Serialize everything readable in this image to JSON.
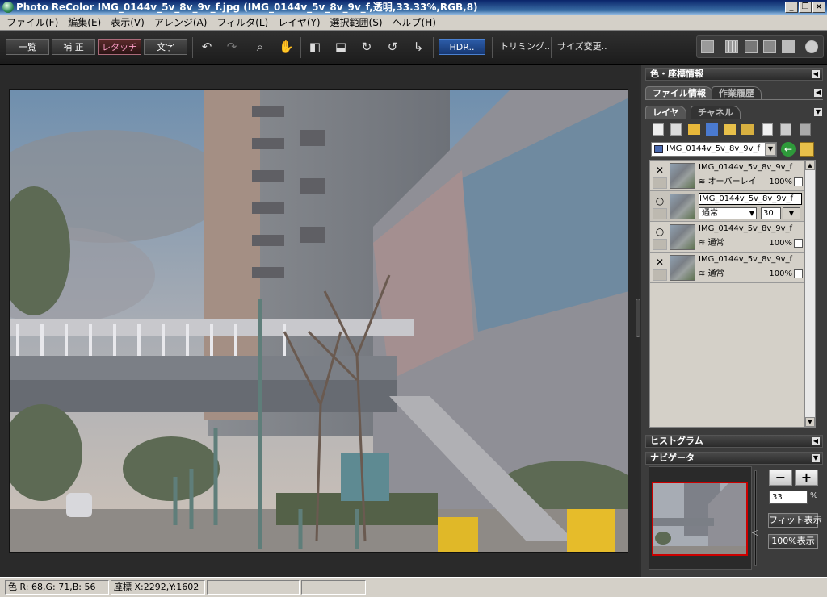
{
  "window": {
    "title": "Photo ReColor IMG_0144v_5v_8v_9v_f.jpg (IMG_0144v_5v_8v_9v_f,透明,33.33%,RGB,8)",
    "minimize": "_",
    "maximize": "❐",
    "close": "×"
  },
  "menu": [
    "ファイル(F)",
    "編集(E)",
    "表示(V)",
    "アレンジ(A)",
    "フィルタ(L)",
    "レイヤ(Y)",
    "選択範囲(S)",
    "ヘルプ(H)"
  ],
  "toolbar": {
    "list": "一覧",
    "correct": "補 正",
    "retouch": "レタッチ",
    "text": "文字",
    "hdr": "HDR..",
    "trimming": "トリミング..",
    "resize": "サイズ変更..",
    "undo_icon": "↶",
    "redo_icon": "↷",
    "zoom_icon": "⌕",
    "hand_icon": "✋",
    "flip_h_icon": "◧",
    "flip_v_icon": "⬓",
    "rotate_cw_icon": "↻",
    "rotate_ccw_icon": "↺",
    "rotate_free_icon": "↳"
  },
  "panel": {
    "color_coord": "色・座標情報",
    "tab_file_info": "ファイル情報",
    "tab_history": "作業履歴",
    "tab_layer": "レイヤ",
    "tab_channel": "チャネル",
    "layer_select": "IMG_0144v_5v_8v_9v_f",
    "histogram": "ヒストグラム",
    "navigator": "ナビゲータ"
  },
  "layers": [
    {
      "vis": "✕",
      "name": "IMG_0144v_5v_8v_9v_f",
      "mode": "オーバーレイ",
      "opacity": "100%"
    },
    {
      "vis": "○",
      "name": "IMG_0144v_5v_8v_9v_f",
      "mode": "通常",
      "opacity": "30"
    },
    {
      "vis": "○",
      "name": "IMG_0144v_5v_8v_9v_f",
      "mode": "通常",
      "opacity": "100%"
    },
    {
      "vis": "✕",
      "name": "IMG_0144v_5v_8v_9v_f",
      "mode": "通常",
      "opacity": "100%"
    }
  ],
  "navigator": {
    "zoom": "33",
    "unit": "%",
    "minus": "−",
    "plus": "+",
    "fit": "フィット表示",
    "full": "100%表示"
  },
  "status": {
    "color": "色 R: 68,G: 71,B: 56",
    "coord": "座標 X:2292,Y:1602"
  }
}
